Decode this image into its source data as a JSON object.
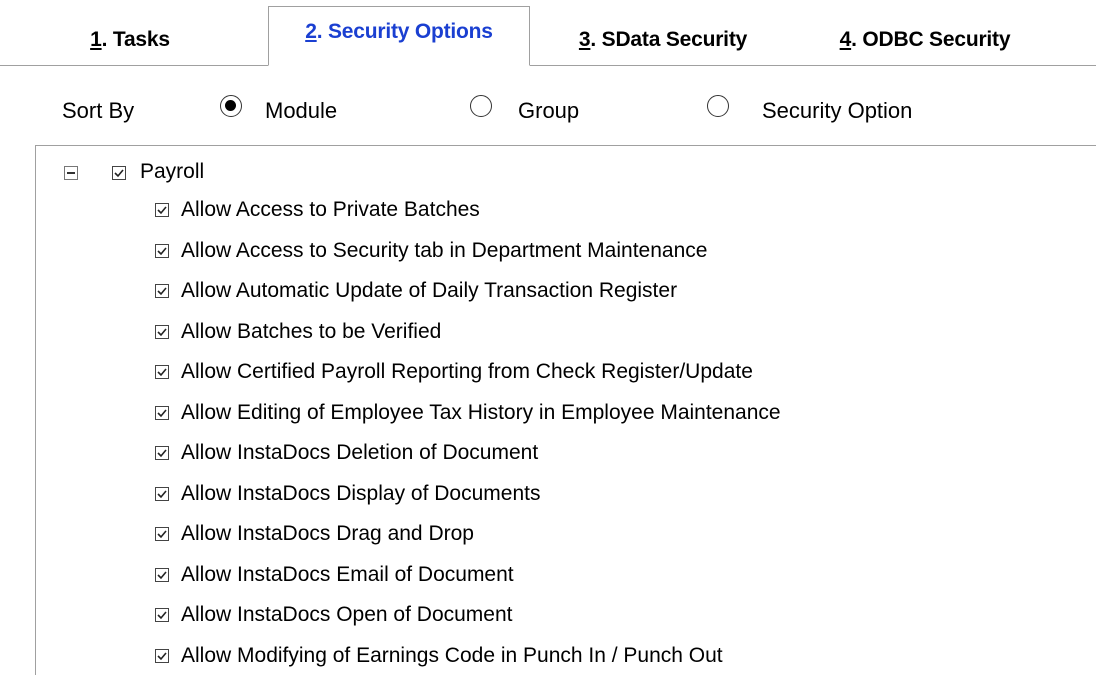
{
  "tabs": [
    {
      "key": "1",
      "rest": ". Tasks",
      "active": false
    },
    {
      "key": "2",
      "rest": ". Security Options",
      "active": true
    },
    {
      "key": "3",
      "rest": ". SData Security",
      "active": false
    },
    {
      "key": "4",
      "rest": ". ODBC Security",
      "active": false
    }
  ],
  "sort": {
    "label": "Sort By",
    "options": [
      {
        "label": "Module",
        "checked": true
      },
      {
        "label": "Group",
        "checked": false
      },
      {
        "label": "Security Option",
        "checked": false
      }
    ]
  },
  "tree": {
    "root": {
      "label": "Payroll",
      "checked": true,
      "expanded": true
    },
    "items": [
      {
        "label": "Allow Access to Private Batches",
        "checked": true
      },
      {
        "label": "Allow Access to Security tab in Department Maintenance",
        "checked": true
      },
      {
        "label": "Allow Automatic Update of Daily Transaction Register",
        "checked": true
      },
      {
        "label": "Allow Batches to be Verified",
        "checked": true
      },
      {
        "label": "Allow Certified Payroll Reporting from Check Register/Update",
        "checked": true
      },
      {
        "label": "Allow Editing of Employee Tax History in Employee Maintenance",
        "checked": true
      },
      {
        "label": "Allow InstaDocs Deletion of Document",
        "checked": true
      },
      {
        "label": "Allow InstaDocs Display of Documents",
        "checked": true
      },
      {
        "label": "Allow InstaDocs Drag and Drop",
        "checked": true
      },
      {
        "label": "Allow InstaDocs Email of Document",
        "checked": true
      },
      {
        "label": "Allow InstaDocs Open of Document",
        "checked": true
      },
      {
        "label": "Allow Modifying of Earnings Code in Punch In / Punch Out",
        "checked": true
      }
    ]
  }
}
